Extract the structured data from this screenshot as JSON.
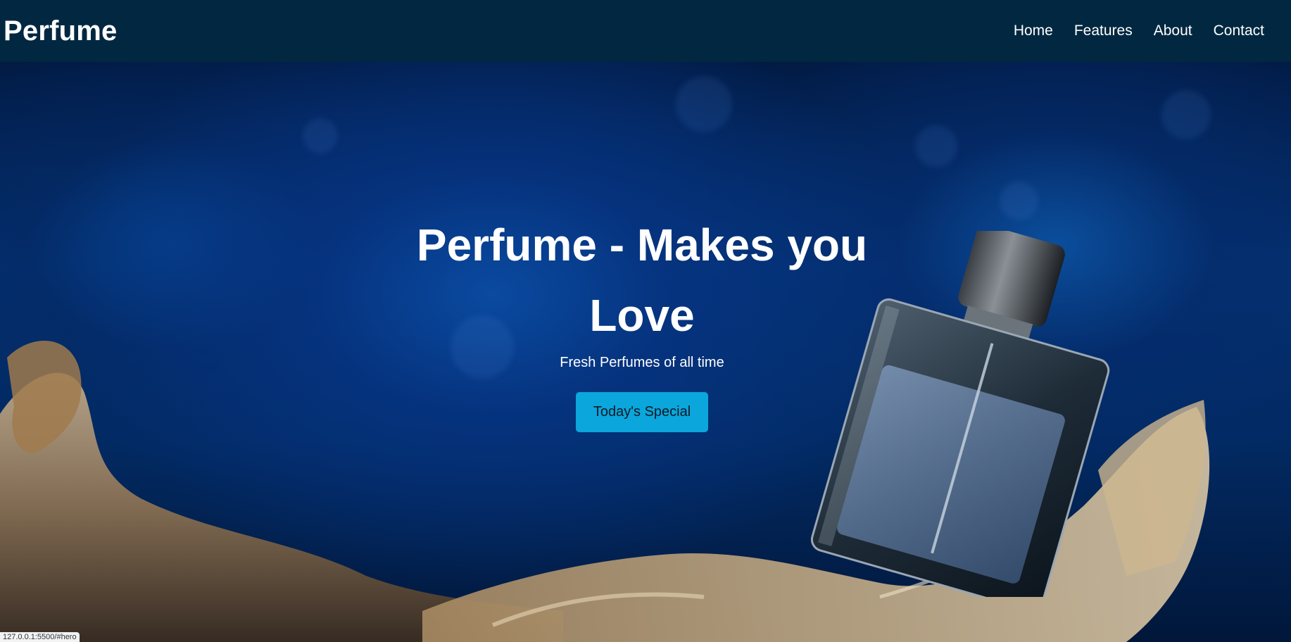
{
  "navbar": {
    "brand": "Perfume",
    "links": [
      "Home",
      "Features",
      "About",
      "Contact"
    ]
  },
  "hero": {
    "title": "Perfume - Makes you Love",
    "subtitle": "Fresh Perfumes of all time",
    "cta_label": "Today's Special"
  },
  "status_bar": {
    "url": "127.0.0.1:5500/#hero"
  },
  "colors": {
    "navbar_bg": "#012840",
    "cta_bg": "#0aa6dc",
    "hero_bg": "#03306f"
  }
}
